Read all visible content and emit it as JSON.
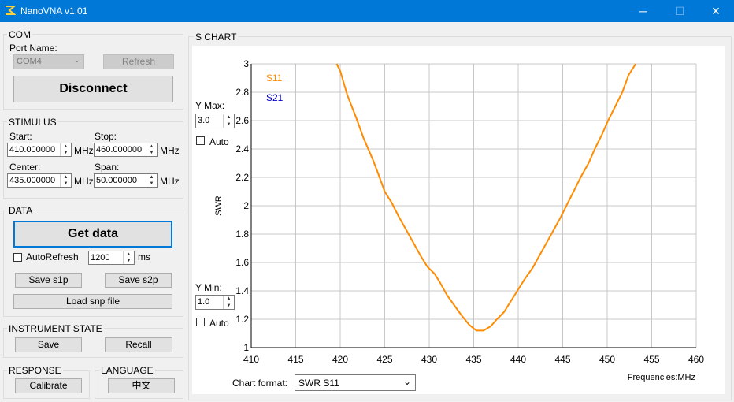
{
  "window": {
    "title": "NanoVNA v1.01",
    "minimize": "─",
    "maximize": "☐",
    "close": "✕"
  },
  "com": {
    "label": "COM",
    "port_label": "Port Name:",
    "port_value": "COM4",
    "refresh": "Refresh",
    "disconnect": "Disconnect"
  },
  "stimulus": {
    "label": "STIMULUS",
    "start_label": "Start:",
    "start_value": "410.000000",
    "start_unit": "MHz",
    "stop_label": "Stop:",
    "stop_value": "460.000000",
    "stop_unit": "MHz",
    "center_label": "Center:",
    "center_value": "435.000000",
    "center_unit": "MHz",
    "span_label": "Span:",
    "span_value": "50.000000",
    "span_unit": "MHz"
  },
  "data": {
    "label": "DATA",
    "get_data": "Get data",
    "autorefresh_label": "AutoRefresh",
    "autorefresh_value": "1200",
    "autorefresh_unit": "ms",
    "save_s1p": "Save s1p",
    "save_s2p": "Save s2p",
    "load_snp": "Load snp file"
  },
  "instrument": {
    "label": "INSTRUMENT STATE",
    "save": "Save",
    "recall": "Recall"
  },
  "response": {
    "label": "RESPONSE",
    "calibrate": "Calibrate"
  },
  "language": {
    "label": "LANGUAGE",
    "button": "中文"
  },
  "schart": {
    "label": "S CHART",
    "ymax_label": "Y Max:",
    "ymax_value": "3.0",
    "ymax_auto": "Auto",
    "ymin_label": "Y Min:",
    "ymin_value": "1.0",
    "ymin_auto": "Auto",
    "chart_format_label": "Chart format:",
    "chart_format_value": "SWR S11"
  },
  "colors": {
    "s11": "#ff8c00",
    "s21": "#0000cd",
    "grid": "#c8c8c8",
    "accent": "#0078d7"
  },
  "chart_data": {
    "type": "line",
    "xlabel": "Frequencies:MHz",
    "ylabel": "SWR",
    "xlim": [
      410,
      460
    ],
    "ylim": [
      1,
      3
    ],
    "x_ticks": [
      "410",
      "415",
      "420",
      "425",
      "430",
      "435",
      "440",
      "445",
      "450",
      "455",
      "460"
    ],
    "y_ticks": [
      "3",
      "2.8",
      "2.6",
      "2.4",
      "2.2",
      "2",
      "1.8",
      "1.6",
      "1.4",
      "1.2",
      "1"
    ],
    "legend": [
      "S11",
      "S21"
    ],
    "series": [
      {
        "name": "S11",
        "x": [
          419.6,
          420.0,
          420.8,
          421.8,
          422.6,
          423.7,
          424.3,
          425.0,
          425.8,
          426.6,
          427.5,
          428.3,
          429.1,
          429.8,
          430.6,
          431.2,
          432.0,
          432.8,
          433.6,
          434.5,
          435.3,
          436.1,
          436.9,
          437.6,
          438.4,
          439.1,
          439.9,
          440.7,
          441.6,
          442.4,
          443.2,
          443.9,
          444.7,
          445.5,
          446.3,
          447.1,
          447.9,
          448.6,
          449.4,
          450.1,
          450.9,
          451.7,
          452.4,
          453.2
        ],
        "y": [
          3.0,
          2.95,
          2.78,
          2.62,
          2.48,
          2.32,
          2.22,
          2.1,
          2.02,
          1.92,
          1.82,
          1.73,
          1.64,
          1.57,
          1.52,
          1.46,
          1.37,
          1.3,
          1.23,
          1.16,
          1.12,
          1.12,
          1.15,
          1.2,
          1.25,
          1.32,
          1.4,
          1.48,
          1.56,
          1.65,
          1.74,
          1.82,
          1.91,
          2.01,
          2.11,
          2.21,
          2.3,
          2.4,
          2.5,
          2.6,
          2.7,
          2.8,
          2.92,
          3.0
        ]
      }
    ]
  }
}
